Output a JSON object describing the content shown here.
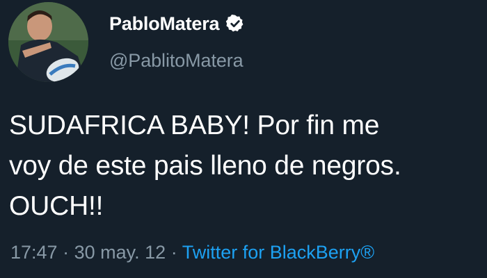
{
  "profile": {
    "display_name": "PabloMatera",
    "handle": "@PablitoMatera",
    "verified": true
  },
  "tweet": {
    "text": "SUDAFRICA BABY! Por fin me\nvoy de este pais lleno de negros.\nOUCH!!",
    "time": "17:47",
    "separator_1": "·",
    "date": "30 may. 12",
    "separator_2": "·",
    "source": "Twitter for BlackBerry®"
  },
  "icons": {
    "verified": "verified-badge-icon"
  },
  "colors": {
    "background": "#15202b",
    "text": "#ffffff",
    "secondary_text": "#8899a6",
    "link": "#1da1f2"
  }
}
